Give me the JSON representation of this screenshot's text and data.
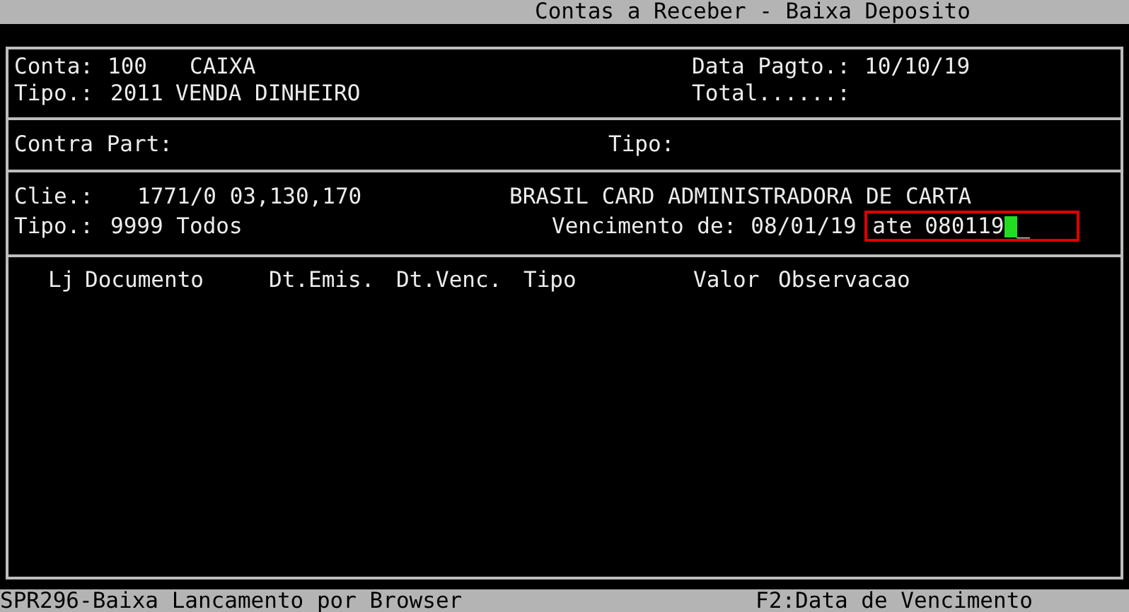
{
  "window": {
    "title": "Contas a Receber - Baixa Deposito"
  },
  "account": {
    "conta_label": "Conta:",
    "conta_code": "100",
    "conta_name": "CAIXA",
    "tipo_label": "Tipo.:",
    "tipo_code": "2011",
    "tipo_name": "VENDA DINHEIRO",
    "data_label": "Data Pagto.:",
    "data_value": "10/10/19",
    "total_label": "Total......:"
  },
  "counterpart": {
    "label": "Contra Part:",
    "tipo_label": "Tipo:"
  },
  "client": {
    "label": "Clie.:",
    "code": "1771/0 03,130,170",
    "name": "BRASIL CARD ADMINISTRADORA DE CARTA",
    "tipo_label": "Tipo.:",
    "tipo_value": "9999 Todos"
  },
  "due_filter": {
    "label": "Vencimento de:",
    "from": "08/01/19",
    "to_label": "ate",
    "to_value": "080119",
    "cursor": "_",
    "highlighted": true
  },
  "table": {
    "columns": [
      "Lj",
      "Documento",
      "Dt.Emis.",
      "Dt.Venc.",
      "Tipo",
      "Valor",
      "Observacao"
    ]
  },
  "status_bar": {
    "program": "SPR296-Baixa Lancamento por Browser",
    "hint": "F2:Data de Vencimento"
  }
}
